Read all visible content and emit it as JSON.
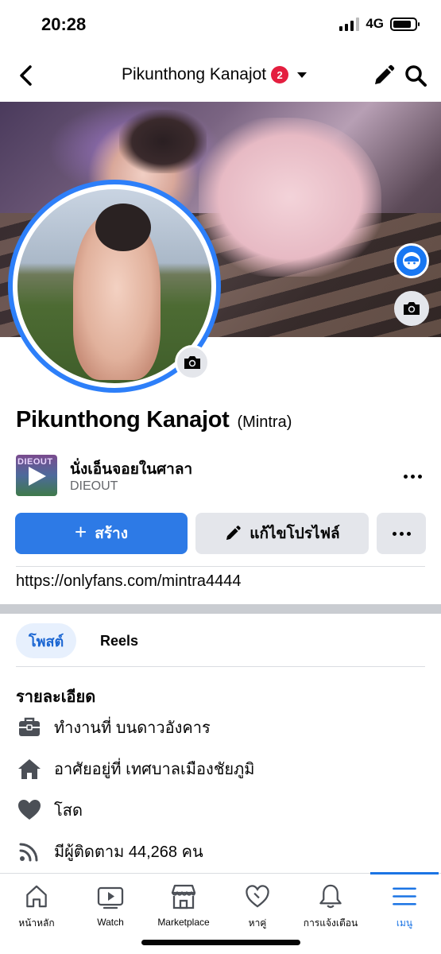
{
  "status_bar": {
    "time": "20:28",
    "network": "4G",
    "signal_bars": 3,
    "battery_level": 0.85
  },
  "header": {
    "profile_name": "Pikunthong Kanajot",
    "notification_count": "2",
    "icons": [
      "back-icon",
      "caret-down-icon",
      "edit-pencil-icon",
      "search-icon"
    ]
  },
  "cover": {
    "buttons": [
      "avatar-sticker-icon",
      "camera-icon"
    ]
  },
  "profile": {
    "name": "Pikunthong Kanajot",
    "alternate_name": "(Mintra)"
  },
  "music": {
    "title": "นั่งเอ็นจอยในศาลา",
    "artist": "DIEOUT",
    "thumb_text": "DIEOUT"
  },
  "actions": {
    "create_label": "สร้าง",
    "create_icon": "+",
    "edit_label": "แก้ไขโปรไฟล์"
  },
  "link": "https://onlyfans.com/mintra4444",
  "tabs": [
    {
      "label": "โพสต์",
      "active": true
    },
    {
      "label": "Reels",
      "active": false
    }
  ],
  "details": {
    "heading": "รายละเอียด",
    "items": [
      {
        "icon": "briefcase-icon",
        "text": "ทำงานที่ บนดาวอังคาร"
      },
      {
        "icon": "home-icon",
        "text": "อาศัยอยู่ที่ เทศบาลเมืองชัยภูมิ"
      },
      {
        "icon": "heart-icon",
        "text": "โสด"
      },
      {
        "icon": "rss-icon",
        "text": "มีผู้ติดตาม 44,268 คน"
      }
    ]
  },
  "bottom_nav": [
    {
      "label": "หน้าหลัก",
      "icon": "home-icon",
      "active": false
    },
    {
      "label": "Watch",
      "icon": "watch-icon",
      "active": false
    },
    {
      "label": "Marketplace",
      "icon": "marketplace-icon",
      "active": false
    },
    {
      "label": "หาคู่",
      "icon": "dating-icon",
      "active": false
    },
    {
      "label": "การแจ้งเตือน",
      "icon": "bell-icon",
      "active": false
    },
    {
      "label": "เมนู",
      "icon": "menu-icon",
      "active": true
    }
  ],
  "colors": {
    "accent": "#1b74e4",
    "button_primary": "#2d7ae6",
    "button_secondary": "#e4e6eb",
    "badge": "#e41e3f",
    "avatar_ring": "#2d7ff9"
  }
}
